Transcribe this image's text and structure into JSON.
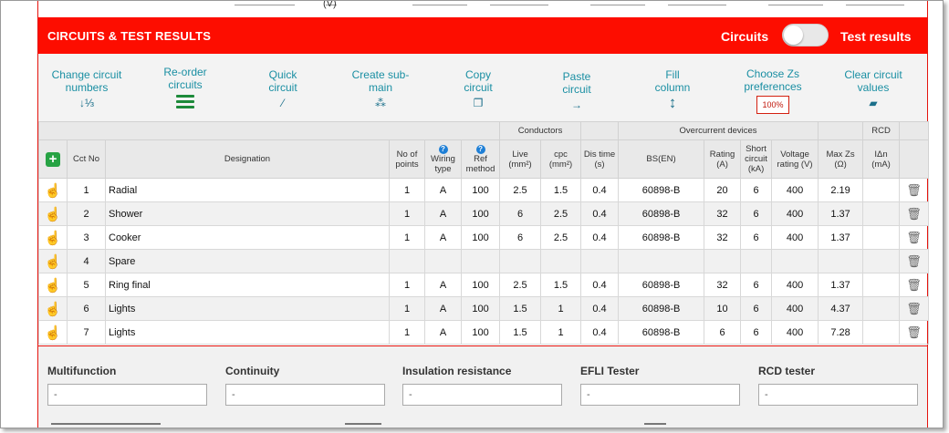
{
  "panel": {
    "title": "CIRCUITS & TEST RESULTS",
    "toggle_left": "Circuits",
    "toggle_right": "Test results",
    "top_unit": "(V)"
  },
  "toolbar": [
    {
      "id": "change",
      "label": "Change circuit numbers",
      "icon": "sort-numeric-icon",
      "glyph": "↓⅓"
    },
    {
      "id": "reorder",
      "label": "Re-order circuits",
      "icon": "reorder-bars-icon",
      "glyph": ""
    },
    {
      "id": "quick",
      "label": "Quick circuit",
      "icon": "magic-wand-icon",
      "glyph": "⁄"
    },
    {
      "id": "submain",
      "label": "Create sub-main",
      "icon": "sitemap-icon",
      "glyph": "⁂"
    },
    {
      "id": "copy",
      "label": "Copy circuit",
      "icon": "copy-icon",
      "glyph": "❐"
    },
    {
      "id": "paste",
      "label": "Paste circuit",
      "icon": "arrow-right-icon",
      "glyph": "→"
    },
    {
      "id": "fill",
      "label": "Fill column",
      "icon": "arrow-vertical-icon",
      "glyph": "↕"
    },
    {
      "id": "zs",
      "label": "Choose Zs preferences",
      "icon": "zs-percent-box",
      "glyph": "100%"
    },
    {
      "id": "clear",
      "label": "Clear circuit values",
      "icon": "eraser-icon",
      "glyph": "▰"
    }
  ],
  "table": {
    "groups": {
      "conductors": "Conductors",
      "overcurrent": "Overcurrent devices",
      "rcd": "RCD"
    },
    "headers": {
      "cct_no": "Cct No",
      "designation": "Designation",
      "no_points": "No of points",
      "wiring": "Wiring type",
      "ref": "Ref method",
      "live": "Live (mm²)",
      "cpc": "cpc (mm²)",
      "dis": "Dis time (s)",
      "bsen": "BS(EN)",
      "rating": "Rating (A)",
      "short": "Short circuit (kA)",
      "voltage": "Voltage rating (V)",
      "maxzs": "Max Zs (Ω)",
      "idn": "IΔn (mA)"
    },
    "rows": [
      {
        "no": "1",
        "designation": "Radial",
        "points": "1",
        "wiring": "A",
        "ref": "100",
        "live": "2.5",
        "cpc": "1.5",
        "dis": "0.4",
        "bsen": "60898-B",
        "rating": "20",
        "short": "6",
        "voltage": "400",
        "maxzs": "2.19",
        "idn": ""
      },
      {
        "no": "2",
        "designation": "Shower",
        "points": "1",
        "wiring": "A",
        "ref": "100",
        "live": "6",
        "cpc": "2.5",
        "dis": "0.4",
        "bsen": "60898-B",
        "rating": "32",
        "short": "6",
        "voltage": "400",
        "maxzs": "1.37",
        "idn": ""
      },
      {
        "no": "3",
        "designation": "Cooker",
        "points": "1",
        "wiring": "A",
        "ref": "100",
        "live": "6",
        "cpc": "2.5",
        "dis": "0.4",
        "bsen": "60898-B",
        "rating": "32",
        "short": "6",
        "voltage": "400",
        "maxzs": "1.37",
        "idn": ""
      },
      {
        "no": "4",
        "designation": "Spare",
        "points": "",
        "wiring": "",
        "ref": "",
        "live": "",
        "cpc": "",
        "dis": "",
        "bsen": "",
        "rating": "",
        "short": "",
        "voltage": "",
        "maxzs": "",
        "idn": ""
      },
      {
        "no": "5",
        "designation": "Ring final",
        "points": "1",
        "wiring": "A",
        "ref": "100",
        "live": "2.5",
        "cpc": "1.5",
        "dis": "0.4",
        "bsen": "60898-B",
        "rating": "32",
        "short": "6",
        "voltage": "400",
        "maxzs": "1.37",
        "idn": ""
      },
      {
        "no": "6",
        "designation": "Lights",
        "points": "1",
        "wiring": "A",
        "ref": "100",
        "live": "1.5",
        "cpc": "1",
        "dis": "0.4",
        "bsen": "60898-B",
        "rating": "10",
        "short": "6",
        "voltage": "400",
        "maxzs": "4.37",
        "idn": ""
      },
      {
        "no": "7",
        "designation": "Lights",
        "points": "1",
        "wiring": "A",
        "ref": "100",
        "live": "1.5",
        "cpc": "1",
        "dis": "0.4",
        "bsen": "60898-B",
        "rating": "6",
        "short": "6",
        "voltage": "400",
        "maxzs": "7.28",
        "idn": ""
      }
    ]
  },
  "testers": [
    {
      "label": "Multifunction",
      "value": "-"
    },
    {
      "label": "Continuity",
      "value": "-"
    },
    {
      "label": "Insulation resistance",
      "value": "-"
    },
    {
      "label": "EFLI Tester",
      "value": "-"
    },
    {
      "label": "RCD tester",
      "value": "-"
    }
  ],
  "colors": {
    "accent_red": "#fd0d00",
    "link_teal": "#1a8fa3",
    "add_green": "#27a344"
  }
}
